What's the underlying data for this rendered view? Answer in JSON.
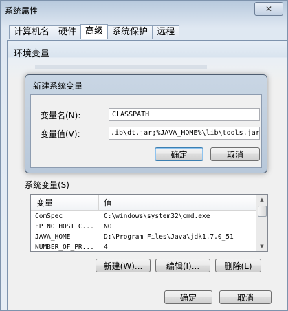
{
  "system_properties": {
    "title": "系统属性",
    "close_label": "✕",
    "tabs": [
      {
        "label": "计算机名"
      },
      {
        "label": "硬件"
      },
      {
        "label": "高级"
      },
      {
        "label": "系统保护"
      },
      {
        "label": "远程"
      }
    ]
  },
  "env_vars": {
    "title": "环境变量",
    "system_vars_label": "系统变量(S)",
    "columns": {
      "name": "变量",
      "value": "值"
    },
    "rows": [
      {
        "name": "ComSpec",
        "value": "C:\\windows\\system32\\cmd.exe"
      },
      {
        "name": "FP_NO_HOST_C...",
        "value": "NO"
      },
      {
        "name": "JAVA_HOME",
        "value": "D:\\Program Files\\Java\\jdk1.7.0_51"
      },
      {
        "name": "NUMBER_OF_PR...",
        "value": "4"
      }
    ],
    "buttons": {
      "new": "新建(W)...",
      "edit": "编辑(I)...",
      "delete": "删除(L)"
    },
    "ok": "确定",
    "cancel": "取消"
  },
  "new_var_dialog": {
    "title": "新建系统变量",
    "name_label": "变量名(N):",
    "name_value": "CLASSPATH",
    "value_label": "变量值(V):",
    "value_value": ".ib\\dt.jar;%JAVA_HOME%\\lib\\tools.jar",
    "ok": "确定",
    "cancel": "取消"
  }
}
